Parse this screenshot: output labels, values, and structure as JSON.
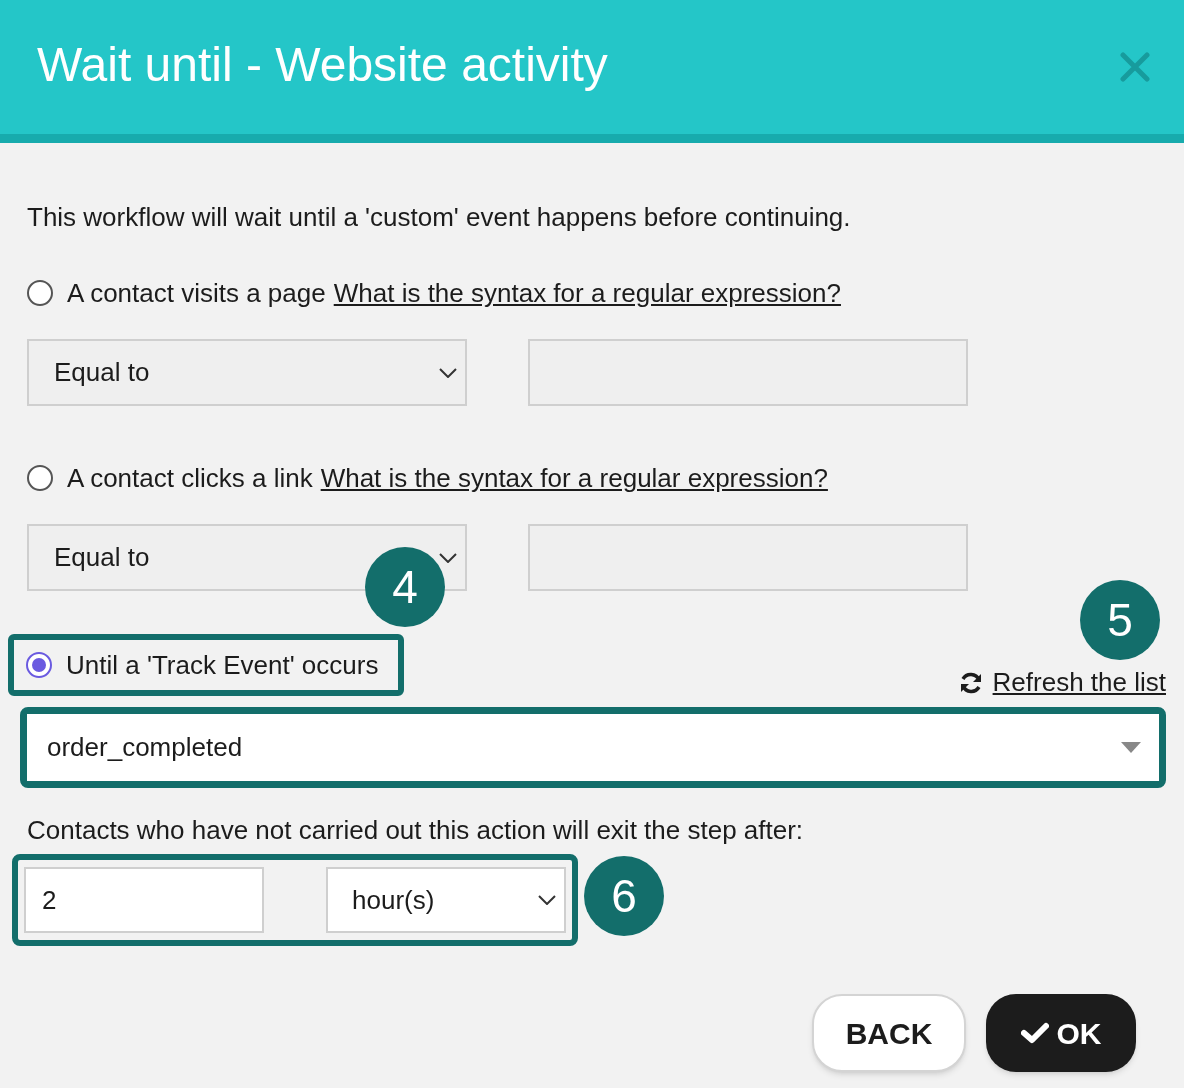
{
  "dialog": {
    "title": "Wait until - Website activity"
  },
  "intro": "This workflow will wait until a 'custom' event happens before continuing.",
  "options": [
    {
      "kind": "url",
      "label": "A contact visits a page",
      "help_link": "What is the syntax for a regular expression?",
      "selected": false,
      "operator": "Equal to"
    },
    {
      "kind": "url",
      "label": "A contact clicks a link",
      "help_link": "What is the syntax for a regular expression?",
      "selected": false,
      "operator": "Equal to"
    },
    {
      "kind": "event",
      "label": "Until a 'Track Event' occurs",
      "selected": true
    }
  ],
  "refresh_link": "Refresh the list",
  "event_select": {
    "value": "order_completed"
  },
  "exit_note": "Contacts who have not carried out this action will exit the step after:",
  "exit_delay": {
    "value": "2",
    "unit": "hour(s)"
  },
  "buttons": [
    {
      "label": "BACK",
      "kind": "secondary"
    },
    {
      "label": "OK",
      "kind": "primary"
    }
  ],
  "callouts": [
    {
      "label": "4"
    },
    {
      "label": "5"
    },
    {
      "label": "6"
    }
  ]
}
